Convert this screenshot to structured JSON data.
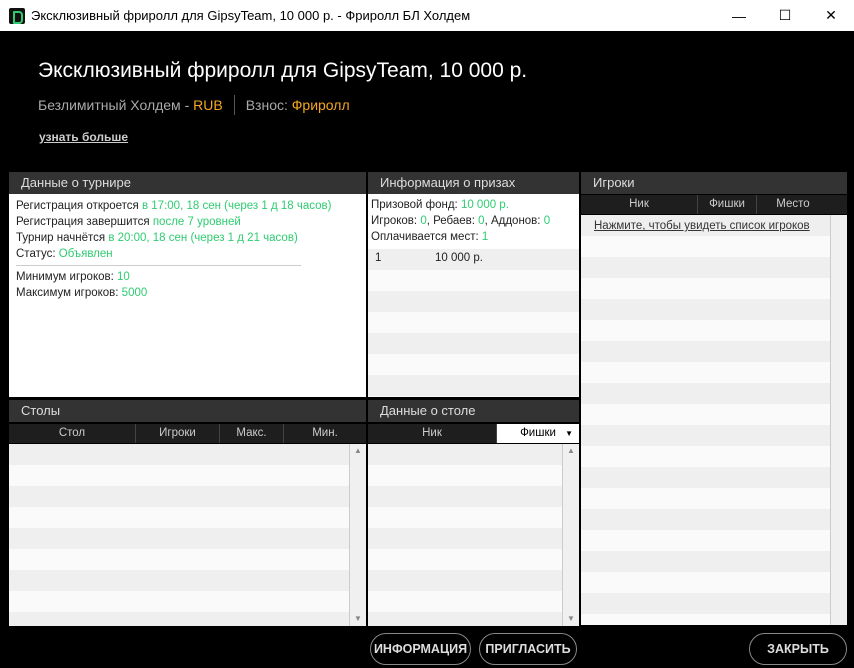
{
  "window": {
    "title": "Эксклюзивный фриролл для GipsyTeam, 10 000 р. - Фриролл БЛ Холдем",
    "minimize": "—",
    "maximize": "☐",
    "close": "✕"
  },
  "header": {
    "title": "Эксклюзивный фриролл для GipsyTeam, 10 000 р.",
    "game": "Безлимитный Холдем - ",
    "currency": "RUB",
    "buyin_label": "Взнос: ",
    "buyin_value": "Фриролл",
    "learn_more": "узнать больше"
  },
  "tournament": {
    "header": "Данные о турнире",
    "reg_open_label": "Регистрация откроется ",
    "reg_open_value": "в 17:00, 18 сен (через 1 д 18 часов)",
    "reg_close_label": "Регистрация завершится ",
    "reg_close_value": "после 7 уровней",
    "start_label": "Турнир начнётся ",
    "start_value": "в 20:00, 18 сен (через 1 д 21 часов)",
    "status_label": "Статус: ",
    "status_value": "Объявлен",
    "min_label": "Минимум игроков: ",
    "min_value": "10",
    "max_label": "Максимум игроков: ",
    "max_value": "5000"
  },
  "prizes": {
    "header": "Информация о призах",
    "fund_label": "Призовой фонд: ",
    "fund_value": "10 000 р.",
    "players_label": "Игроков: ",
    "players_value": "0",
    "rebuys_label": ", Ребаев: ",
    "rebuys_value": "0",
    "addons_label": ", Аддонов: ",
    "addons_value": "0",
    "paid_label": "Оплачивается мест: ",
    "paid_value": "1",
    "rows": [
      {
        "place": "1",
        "amount": "10 000 р."
      }
    ]
  },
  "players": {
    "header": "Игроки",
    "col_nick": "Ник",
    "col_chips": "Фишки",
    "col_place": "Место",
    "show_link": "Нажмите, чтобы увидеть список игроков"
  },
  "tables": {
    "header": "Столы",
    "col_table": "Стол",
    "col_players": "Игроки",
    "col_max": "Макс.",
    "col_min": "Мин."
  },
  "table_data": {
    "header": "Данные о столе",
    "col_nick": "Ник",
    "col_chips": "Фишки",
    "sort_arrow": "▼"
  },
  "buttons": {
    "info": "ИНФОРМАЦИЯ",
    "invite": "ПРИГЛАСИТЬ",
    "close": "ЗАКРЫТЬ"
  },
  "colors": {
    "accent_orange": "#f5a623",
    "accent_green": "#2ecc71"
  }
}
